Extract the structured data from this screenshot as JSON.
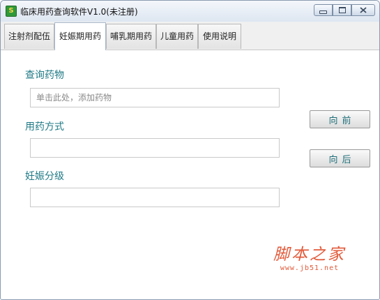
{
  "window": {
    "title": "临床用药查询软件V1.0(未注册)",
    "icon": "app-icon",
    "controls": {
      "minimize": "minimize-icon",
      "maximize": "maximize-icon",
      "close": "close-icon"
    }
  },
  "tabs": [
    {
      "label": "注射剂配伍",
      "active": false
    },
    {
      "label": "妊娠期用药",
      "active": true
    },
    {
      "label": "哺乳期用药",
      "active": false
    },
    {
      "label": "儿童用药",
      "active": false
    },
    {
      "label": "使用说明",
      "active": false
    }
  ],
  "form": {
    "drug_query": {
      "label": "查询药物",
      "placeholder": "单击此处，添加药物",
      "value": ""
    },
    "usage_method": {
      "label": "用药方式",
      "value": ""
    },
    "pregnancy_grade": {
      "label": "妊娠分级",
      "value": ""
    }
  },
  "buttons": {
    "forward": "向前",
    "back": "向后"
  },
  "watermark": {
    "main": "脚本之家",
    "url": "www.jb51.net"
  },
  "colors": {
    "label": "#1f7a86",
    "watermark": "#e25a3a"
  }
}
